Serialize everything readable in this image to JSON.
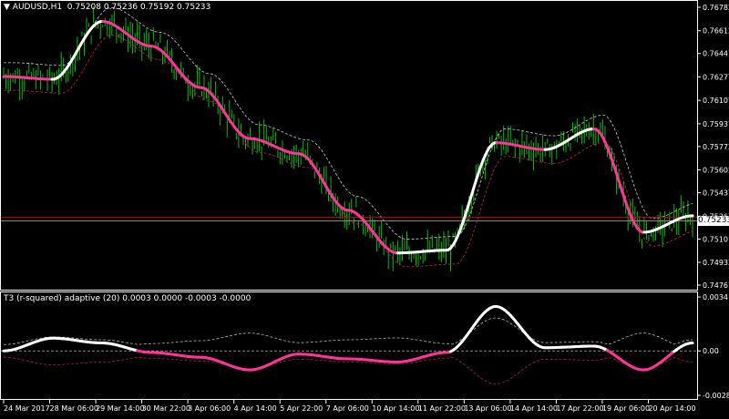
{
  "symbol_header": {
    "symbol": "AUDUSD,H1",
    "ohlc": "0.75208 0.75236 0.75192 0.75233"
  },
  "indicator_header": {
    "label": "T3 (r-squared) adaptive (20) 0.0003 0.0000 -0.0003 -0.0000"
  },
  "price_axis": {
    "ticks": [
      "0.76782",
      "0.76612",
      "0.76447",
      "0.76277",
      "0.76107",
      "0.75937",
      "0.75772",
      "0.75602",
      "0.75437",
      "0.75267",
      "0.75101",
      "0.74932",
      "0.74767"
    ],
    "current_price": "0.75233"
  },
  "indicator_axis": {
    "ticks": [
      "0.0034",
      "0.00",
      "-0.0028"
    ]
  },
  "time_axis": {
    "ticks": [
      "24 Mar 2017",
      "28 Mar 06:00",
      "29 Mar 14:00",
      "30 Mar 22:00",
      "3 Apr 06:00",
      "4 Apr 14:00",
      "5 Apr 22:00",
      "7 Apr 06:00",
      "10 Apr 14:00",
      "11 Apr 22:00",
      "13 Apr 06:00",
      "14 Apr 14:00",
      "17 Apr 22:00",
      "19 Apr 06:00",
      "20 Apr 14:00"
    ]
  },
  "colors": {
    "background": "#000000",
    "candles": "#00c000",
    "t3_up": "#ffffff",
    "t3_down": "#ff3399",
    "band_upper": "#cccccc",
    "band_lower": "#cc2244",
    "hline": "#cc0000",
    "axis": "#ffffff"
  },
  "chart_data": {
    "type": "line",
    "x": [
      "24 Mar 2017",
      "28 Mar 06:00",
      "29 Mar 14:00",
      "30 Mar 22:00",
      "3 Apr 06:00",
      "4 Apr 14:00",
      "5 Apr 22:00",
      "7 Apr 06:00",
      "10 Apr 14:00",
      "11 Apr 22:00",
      "13 Apr 06:00",
      "14 Apr 14:00",
      "17 Apr 22:00",
      "19 Apr 06:00",
      "20 Apr 14:00"
    ],
    "price_series": [
      {
        "values": [
          0.7628,
          0.7626,
          0.7668,
          0.765,
          0.762,
          0.7583,
          0.7572,
          0.7531,
          0.75,
          0.7502,
          0.758,
          0.7575,
          0.759,
          0.7515,
          0.7527
        ]
      }
    ],
    "indicator_series": [
      {
        "values": [
          0.0,
          0.0008,
          0.0005,
          -0.0001,
          -0.0004,
          -0.0012,
          -0.0002,
          -0.0005,
          -0.0007,
          -0.0001,
          0.0028,
          0.0002,
          0.0003,
          -0.0012,
          0.0005
        ]
      }
    ],
    "price_ylim": [
      0.74767,
      0.76782
    ],
    "indicator_ylim": [
      -0.0028,
      0.0034
    ],
    "current_price": 0.75233,
    "horizontal_line": 0.7526,
    "grid": false
  }
}
